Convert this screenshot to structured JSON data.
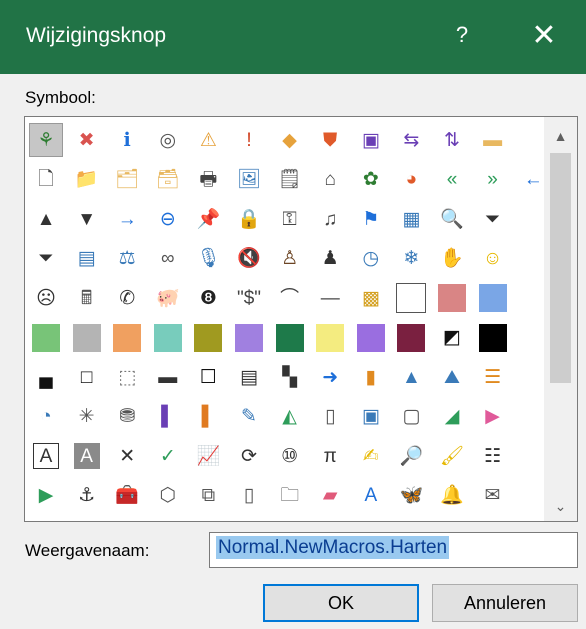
{
  "title": "Wijzigingsknop",
  "help_glyph": "?",
  "close_glyph": "✕",
  "symbol_label": "Symbool:",
  "display_name_label": "Weergavenaam:",
  "display_name_value": "Normal.NewMacros.Harten",
  "ok_label": "OK",
  "cancel_label": "Annuleren",
  "scroll_up_glyph": "▲",
  "scroll_down_glyph": "⌄",
  "selected_index": 0,
  "rows": [
    [
      {
        "name": "org-chart-icon",
        "glyph": "⚘",
        "color": "#2e7d32"
      },
      {
        "name": "error-icon",
        "glyph": "✖",
        "color": "#d9534f"
      },
      {
        "name": "info-icon",
        "glyph": "ℹ",
        "color": "#1e6fd9"
      },
      {
        "name": "stop-circle-icon",
        "glyph": "◎",
        "color": "#555555"
      },
      {
        "name": "warning-icon",
        "glyph": "⚠",
        "color": "#e6a23c"
      },
      {
        "name": "exclamation-icon",
        "glyph": "!",
        "color": "#d04020"
      },
      {
        "name": "diamond-warning-icon",
        "glyph": "◆",
        "color": "#e6a23c"
      },
      {
        "name": "shield-icon",
        "glyph": "⛊",
        "color": "#e05a2a"
      },
      {
        "name": "save-icon",
        "glyph": "▣",
        "color": "#6a3fb5"
      },
      {
        "name": "copy-to-icon",
        "glyph": "⇆",
        "color": "#6a3fb5"
      },
      {
        "name": "move-to-icon",
        "glyph": "⇅",
        "color": "#6a3fb5"
      },
      {
        "name": "folder-icon",
        "glyph": "▬",
        "color": "#e8b860"
      }
    ],
    [
      {
        "name": "new-document-icon",
        "glyph": "🗋",
        "color": "#444444"
      },
      {
        "name": "folder-up-icon",
        "glyph": "📁",
        "color": "#e8b860"
      },
      {
        "name": "folders-icon",
        "glyph": "🗂",
        "color": "#e8b860"
      },
      {
        "name": "folder-list-icon",
        "glyph": "🗃",
        "color": "#e8b860"
      },
      {
        "name": "printer-icon",
        "glyph": "🖶",
        "color": "#444444"
      },
      {
        "name": "picture-icon",
        "glyph": "🖼",
        "color": "#3a7ab8"
      },
      {
        "name": "notes-icon",
        "glyph": "🗒",
        "color": "#444444"
      },
      {
        "name": "home-icon",
        "glyph": "⌂",
        "color": "#444444"
      },
      {
        "name": "gear-colored-icon",
        "glyph": "✿",
        "color": "#2e7d32"
      },
      {
        "name": "pie-chart-icon",
        "glyph": "◕",
        "color": "#e05a2a"
      },
      {
        "name": "double-arrow-left-icon",
        "glyph": "«",
        "color": "#2e9d5a"
      },
      {
        "name": "double-arrow-right-icon",
        "glyph": "»",
        "color": "#2e9d5a"
      },
      {
        "name": "arrow-left-icon",
        "glyph": "←",
        "color": "#1e6fd9"
      }
    ],
    [
      {
        "name": "triangle-up-icon",
        "glyph": "▲",
        "color": "#333333"
      },
      {
        "name": "triangle-down-icon",
        "glyph": "▼",
        "color": "#333333"
      },
      {
        "name": "arrow-right-icon",
        "glyph": "→",
        "color": "#1e6fd9"
      },
      {
        "name": "circle-arrow-left-icon",
        "glyph": "⊖",
        "color": "#1e6fd9"
      },
      {
        "name": "pin-icon",
        "glyph": "📌",
        "color": "#333333"
      },
      {
        "name": "lock-icon",
        "glyph": "🔒",
        "color": "#d4a020"
      },
      {
        "name": "key-icon",
        "glyph": "⚿",
        "color": "#444444"
      },
      {
        "name": "scroll-icon",
        "glyph": "♫",
        "color": "#444444"
      },
      {
        "name": "flag-icon",
        "glyph": "⚑",
        "color": "#1e6fd9"
      },
      {
        "name": "window-icon",
        "glyph": "▦",
        "color": "#3a7ab8"
      },
      {
        "name": "magnifier-icon",
        "glyph": "🔍",
        "color": "#444444"
      },
      {
        "name": "filter-icon",
        "glyph": "⏷",
        "color": "#333333"
      }
    ],
    [
      {
        "name": "filter-alt-icon",
        "glyph": "⏷",
        "color": "#333333"
      },
      {
        "name": "reading-icon",
        "glyph": "▤",
        "color": "#3a7ab8"
      },
      {
        "name": "scales-icon",
        "glyph": "⚖",
        "color": "#3a7ab8"
      },
      {
        "name": "rings-icon",
        "glyph": "∞",
        "color": "#555555"
      },
      {
        "name": "microphone-icon",
        "glyph": "🎙",
        "color": "#3a7ab8"
      },
      {
        "name": "mute-icon",
        "glyph": "🔇",
        "color": "#c0392b"
      },
      {
        "name": "person-icon",
        "glyph": "♙",
        "color": "#6b4423"
      },
      {
        "name": "user-silhouette-icon",
        "glyph": "♟",
        "color": "#333333"
      },
      {
        "name": "clock-icon",
        "glyph": "◷",
        "color": "#3a7ab8"
      },
      {
        "name": "snowflake-icon",
        "glyph": "❄",
        "color": "#3a7ab8"
      },
      {
        "name": "hand-icon",
        "glyph": "✋",
        "color": "#555555"
      },
      {
        "name": "smiley-icon",
        "glyph": "☺",
        "color": "#e6b800"
      }
    ],
    [
      {
        "name": "sad-face-icon",
        "glyph": "☹",
        "color": "#333333"
      },
      {
        "name": "calculator-icon",
        "glyph": "🖩",
        "color": "#555555"
      },
      {
        "name": "phone-icon",
        "glyph": "✆",
        "color": "#333333"
      },
      {
        "name": "piggy-bank-icon",
        "glyph": "🐖",
        "color": "#555555"
      },
      {
        "name": "eight-ball-icon",
        "glyph": "❽",
        "color": "#222222"
      },
      {
        "name": "dollar-quote-icon",
        "glyph": "\"$\"",
        "color": "#444444"
      },
      {
        "name": "eye-arc-icon",
        "glyph": "⌒",
        "color": "#444444"
      },
      {
        "name": "dash-icon",
        "glyph": "—",
        "color": "#444444"
      },
      {
        "name": "color-grid-icon",
        "glyph": "▩",
        "color": "#d4a020"
      },
      {
        "name": "swatch-white",
        "swatch": "#ffffff"
      },
      {
        "name": "swatch-rose",
        "swatch": "#d98585"
      },
      {
        "name": "swatch-blue",
        "swatch": "#7aa6e6"
      }
    ],
    [
      {
        "name": "swatch-green",
        "swatch": "#78c478"
      },
      {
        "name": "swatch-gray",
        "swatch": "#b4b4b4"
      },
      {
        "name": "swatch-orange",
        "swatch": "#f0a060"
      },
      {
        "name": "swatch-teal",
        "swatch": "#78ccbc"
      },
      {
        "name": "swatch-olive",
        "swatch": "#a09a20"
      },
      {
        "name": "swatch-lavender",
        "swatch": "#a080e0"
      },
      {
        "name": "swatch-dark-green",
        "swatch": "#1e7a4a"
      },
      {
        "name": "swatch-yellow",
        "swatch": "#f4ec80"
      },
      {
        "name": "swatch-purple",
        "swatch": "#9a6ee0"
      },
      {
        "name": "swatch-maroon",
        "swatch": "#7a2040"
      },
      {
        "name": "diagonal-split-icon",
        "glyph": "◩",
        "color": "#111111"
      },
      {
        "name": "swatch-black",
        "swatch": "#000000"
      }
    ],
    [
      {
        "name": "bottom-border-icon",
        "glyph": "▄",
        "color": "#111111"
      },
      {
        "name": "square-outline-icon",
        "glyph": "□",
        "color": "#111111"
      },
      {
        "name": "dotted-square-icon",
        "glyph": "⬚",
        "color": "#777777"
      },
      {
        "name": "half-square-icon",
        "glyph": "▬",
        "color": "#333333"
      },
      {
        "name": "empty-square-icon",
        "glyph": "☐",
        "color": "#111111"
      },
      {
        "name": "middle-band-icon",
        "glyph": "▤",
        "color": "#333333"
      },
      {
        "name": "checker-icon",
        "glyph": "▚",
        "color": "#333333"
      },
      {
        "name": "circle-arrow-right-icon",
        "glyph": "➜",
        "color": "#1e6fd9"
      },
      {
        "name": "bar-chart-icon",
        "glyph": "▮",
        "color": "#e08a20"
      },
      {
        "name": "cone-icon",
        "glyph": "▲",
        "color": "#3a7ab8"
      },
      {
        "name": "mountains-icon",
        "glyph": "⛰",
        "color": "#3a7ab8"
      },
      {
        "name": "bar-lines-icon",
        "glyph": "☰",
        "color": "#e08a20"
      }
    ],
    [
      {
        "name": "pie-segment-icon",
        "glyph": "◔",
        "color": "#3a7ab8"
      },
      {
        "name": "radar-icon",
        "glyph": "✳",
        "color": "#555555"
      },
      {
        "name": "database-icon",
        "glyph": "⛃",
        "color": "#555555"
      },
      {
        "name": "purple-book-icon",
        "glyph": "▌",
        "color": "#6a3fb5"
      },
      {
        "name": "orange-book-icon",
        "glyph": "▌",
        "color": "#e07a20"
      },
      {
        "name": "picture-edit-icon",
        "glyph": "✎",
        "color": "#3a7ab8"
      },
      {
        "name": "area-chart-icon",
        "glyph": "◭",
        "color": "#2e9d5a"
      },
      {
        "name": "bracket-box-icon",
        "glyph": "▯",
        "color": "#555555"
      },
      {
        "name": "contact-card-icon",
        "glyph": "▣",
        "color": "#3a7ab8"
      },
      {
        "name": "tablet-icon",
        "glyph": "▢",
        "color": "#555555"
      },
      {
        "name": "pencil-line-icon",
        "glyph": "◢",
        "color": "#2e9d5a"
      },
      {
        "name": "flow-arrow-icon",
        "glyph": "▶",
        "color": "#e05a9a"
      }
    ],
    [
      {
        "name": "text-box-a-icon",
        "glyph": "A",
        "color": "#333333"
      },
      {
        "name": "text-a-shaded-icon",
        "glyph": "A",
        "color": "#ffffff"
      },
      {
        "name": "cross-icon",
        "glyph": "✕",
        "color": "#333333"
      },
      {
        "name": "check-icon",
        "glyph": "✓",
        "color": "#2e9d5a"
      },
      {
        "name": "chart-edit-icon",
        "glyph": "📈",
        "color": "#3a7ab8"
      },
      {
        "name": "refresh-icon",
        "glyph": "⟳",
        "color": "#333333"
      },
      {
        "name": "binary-icon",
        "glyph": "⑩",
        "color": "#333333"
      },
      {
        "name": "pi-icon",
        "glyph": "π",
        "color": "#333333"
      },
      {
        "name": "highlighter-icon",
        "glyph": "✍",
        "color": "#e6b800"
      },
      {
        "name": "search-icon",
        "glyph": "🔎",
        "color": "#1e6fd9"
      },
      {
        "name": "brush-icon",
        "glyph": "🖌",
        "color": "#e6b800"
      },
      {
        "name": "list-icon",
        "glyph": "☷",
        "color": "#333333"
      }
    ],
    [
      {
        "name": "play-icon",
        "glyph": "▶",
        "color": "#2e9d5a"
      },
      {
        "name": "anchor-icon",
        "glyph": "⚓",
        "color": "#333333"
      },
      {
        "name": "toolbox-icon",
        "glyph": "🧰",
        "color": "#333333"
      },
      {
        "name": "select-shape-icon",
        "glyph": "⬡",
        "color": "#555555"
      },
      {
        "name": "overlap-squares-icon",
        "glyph": "⧉",
        "color": "#555555"
      },
      {
        "name": "phone-device-icon",
        "glyph": "▯",
        "color": "#555555"
      },
      {
        "name": "tab-folder-icon",
        "glyph": "🗀",
        "color": "#555555"
      },
      {
        "name": "eraser-icon",
        "glyph": "▰",
        "color": "#e05a7a"
      },
      {
        "name": "letter-a-italic-icon",
        "glyph": "A",
        "color": "#1e6fd9"
      },
      {
        "name": "butterfly-icon",
        "glyph": "🦋",
        "color": "#e05a2a"
      },
      {
        "name": "bell-icon",
        "glyph": "🔔",
        "color": "#e6a23c"
      },
      {
        "name": "envelope-open-icon",
        "glyph": "✉",
        "color": "#555555"
      }
    ]
  ]
}
